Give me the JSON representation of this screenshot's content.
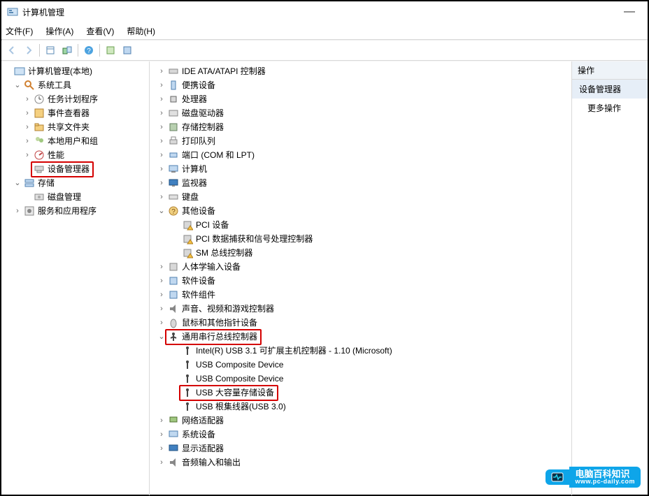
{
  "window": {
    "title": "计算机管理"
  },
  "menu": {
    "file": "文件(F)",
    "action": "操作(A)",
    "view": "查看(V)",
    "help": "帮助(H)"
  },
  "leftTree": {
    "root": "计算机管理(本地)",
    "sysTools": "系统工具",
    "taskSched": "任务计划程序",
    "eventViewer": "事件查看器",
    "sharedFolders": "共享文件夹",
    "localUsers": "本地用户和组",
    "perf": "性能",
    "devMgr": "设备管理器",
    "storage": "存储",
    "diskMgmt": "磁盘管理",
    "services": "服务和应用程序"
  },
  "devTree": {
    "ide": "IDE ATA/ATAPI 控制器",
    "portable": "便携设备",
    "cpu": "处理器",
    "diskDrives": "磁盘驱动器",
    "storageCtrl": "存储控制器",
    "printQ": "打印队列",
    "ports": "端口 (COM 和 LPT)",
    "computer": "计算机",
    "monitor": "监视器",
    "keyboard": "键盘",
    "other": "其他设备",
    "other_pci": "PCI 设备",
    "other_pciSig": "PCI 数据捕获和信号处理控制器",
    "other_sm": "SM 总线控制器",
    "hid": "人体学输入设备",
    "swDev": "软件设备",
    "swComp": "软件组件",
    "sound": "声音、视频和游戏控制器",
    "mouse": "鼠标和其他指针设备",
    "usb": "通用串行总线控制器",
    "usb_intel": "Intel(R) USB 3.1 可扩展主机控制器 - 1.10 (Microsoft)",
    "usb_comp1": "USB Composite Device",
    "usb_comp2": "USB Composite Device",
    "usb_mass": "USB 大容量存储设备",
    "usb_root": "USB 根集线器(USB 3.0)",
    "network": "网络适配器",
    "sysDev": "系统设备",
    "display": "显示适配器",
    "audio": "音频输入和输出"
  },
  "rightPanel": {
    "header": "操作",
    "row1": "设备管理器",
    "row2": "更多操作"
  },
  "watermark": {
    "brand": "电脑百科知识",
    "url": "www.pc-daily.com"
  }
}
